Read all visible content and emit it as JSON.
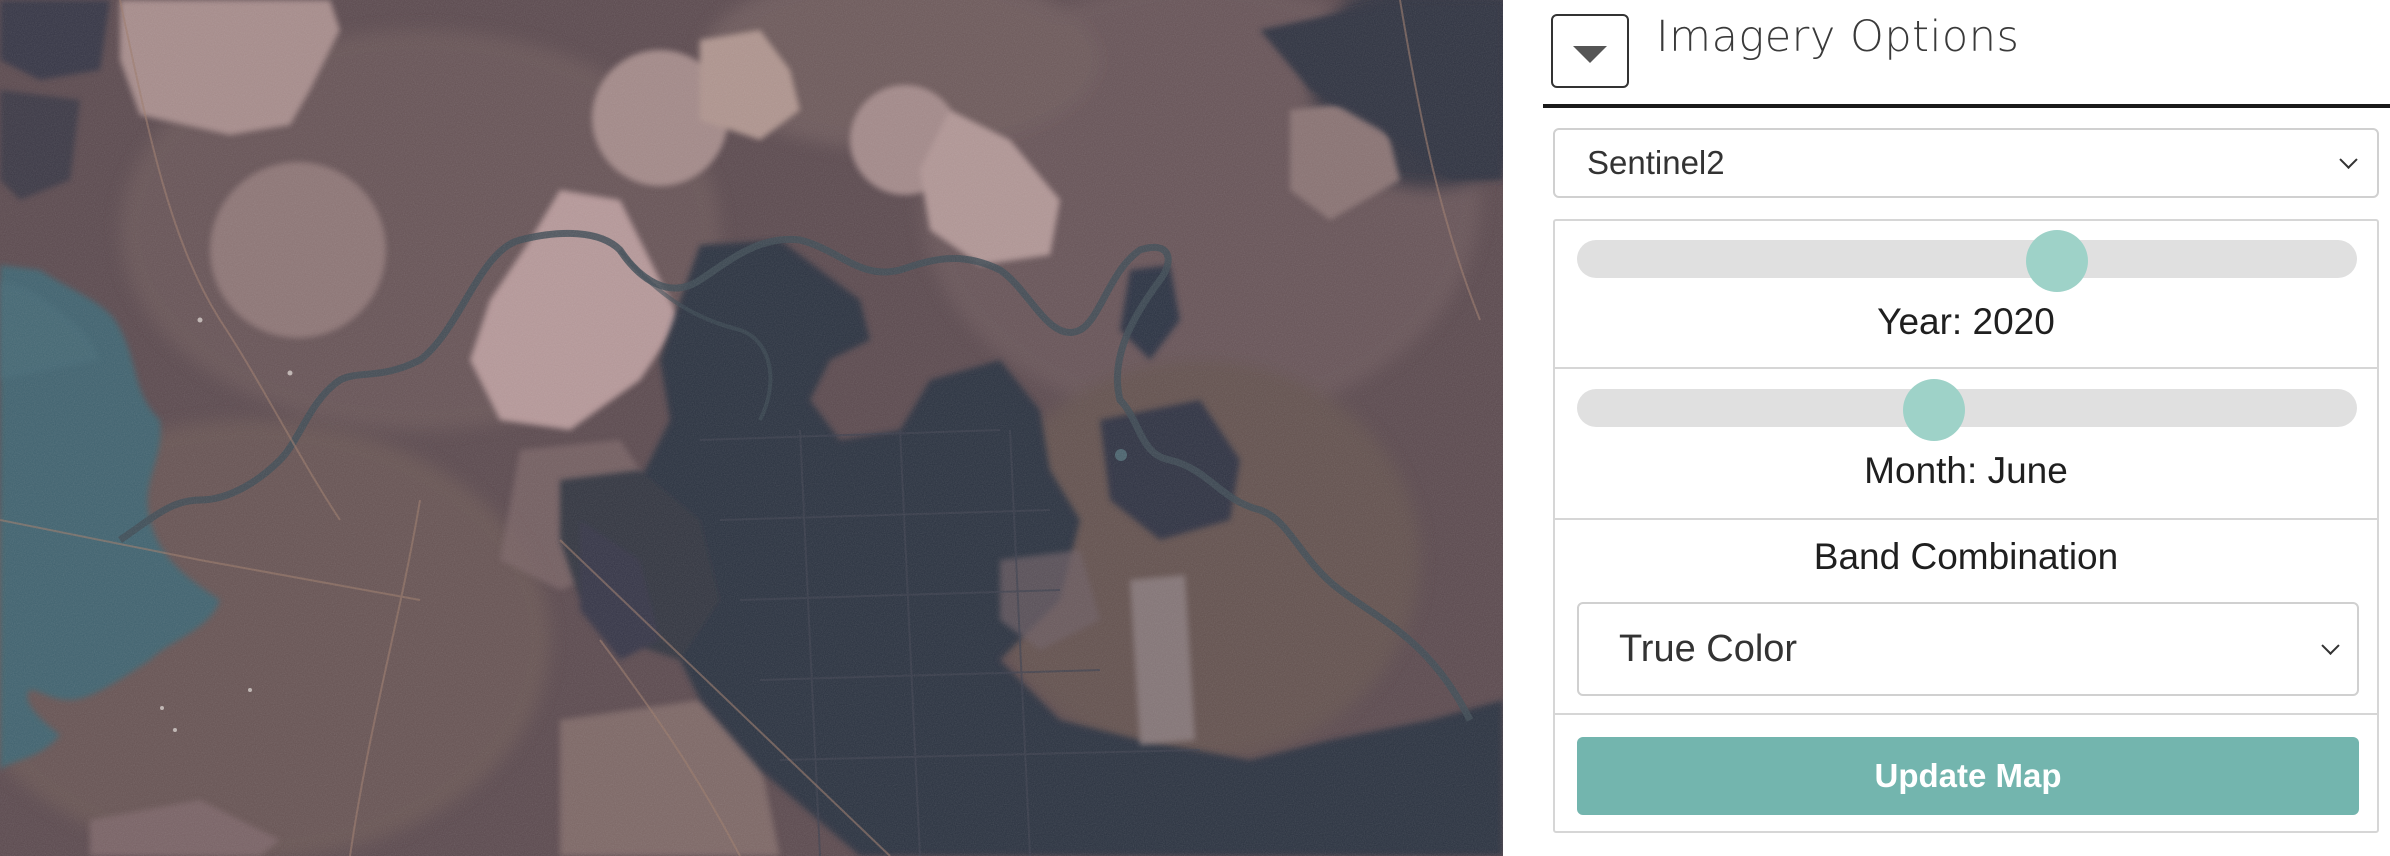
{
  "map": {
    "image_kind": "satellite-imagery",
    "colors": {
      "land": "#5b4a4e",
      "field_light": "#b39593",
      "field_dark": "#2a3142",
      "water": "#3f6370"
    }
  },
  "panel": {
    "title": "Imagery Options",
    "toggle_icon": "caret-down-icon",
    "imagery_source": {
      "selected": "Sentinel2"
    },
    "year_slider": {
      "label": "Year: 2020",
      "value": 2020,
      "position_fraction": 0.615
    },
    "month_slider": {
      "label": "Month: June",
      "value": "June",
      "position_fraction": 0.458
    },
    "band_combination": {
      "title": "Band Combination",
      "selected": "True Color"
    },
    "update_button_label": "Update Map",
    "colors": {
      "accent": "#73b5ae",
      "slider_thumb": "#9ed2c8",
      "slider_track": "#e0e0e0"
    }
  }
}
